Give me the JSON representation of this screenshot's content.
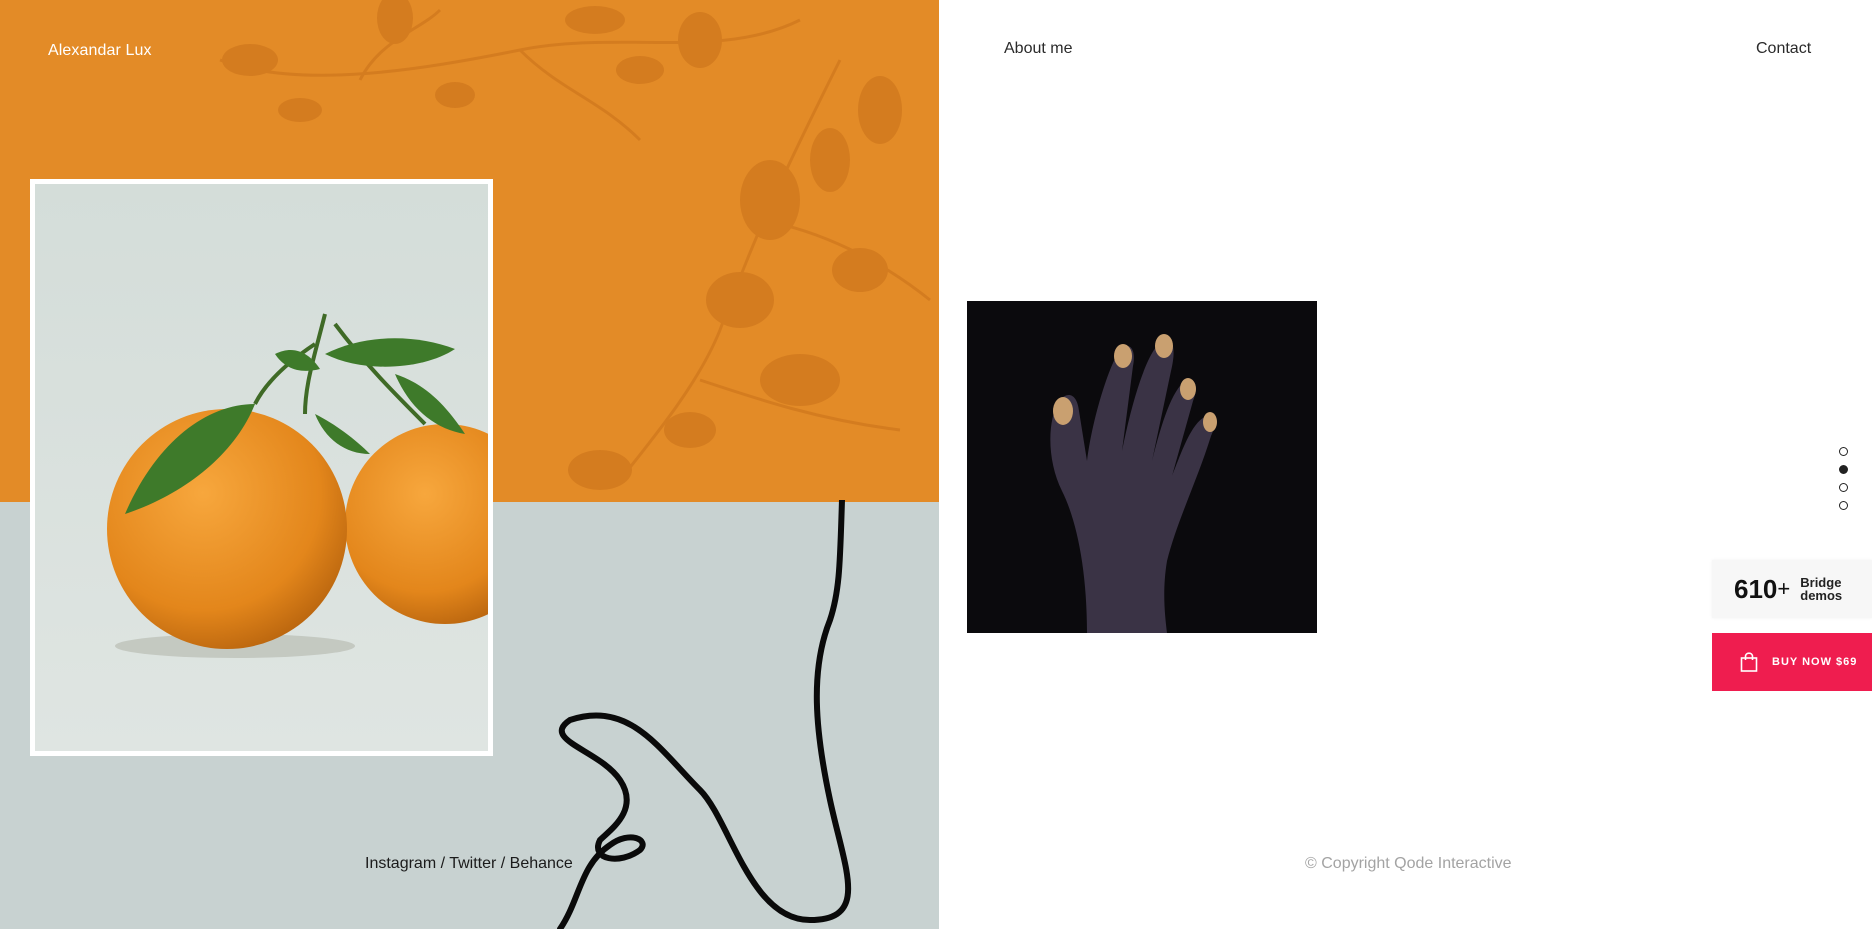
{
  "brand": {
    "name": "Alexandar Lux"
  },
  "nav": {
    "about": "About me",
    "contact": "Contact"
  },
  "social": {
    "text": "Instagram / Twitter / Behance"
  },
  "footer": {
    "copyright": "© Copyright Qode Interactive"
  },
  "slider": {
    "dots": 4,
    "active_index": 1
  },
  "promo": {
    "demos_count": "610",
    "demos_plus": "+",
    "demos_label_line1": "Bridge",
    "demos_label_line2": "demos",
    "buy_label": "BUY NOW $69",
    "buy_icon": "shopping-bag-icon",
    "buy_color": "#ef1d4f"
  },
  "colors": {
    "orange": "#e38b27",
    "sage": "#c8d2d1",
    "white": "#ffffff"
  }
}
